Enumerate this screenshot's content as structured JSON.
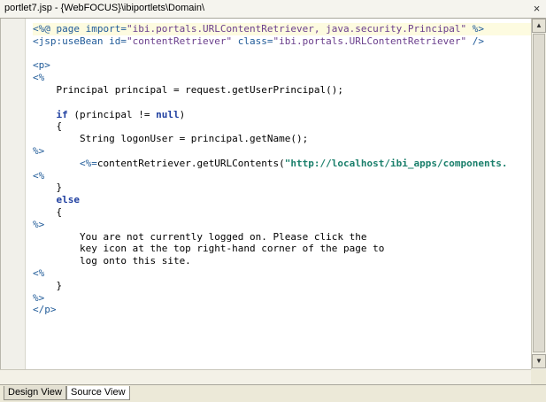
{
  "window": {
    "title": "portlet7.jsp - {WebFOCUS}\\ibiportlets\\Domain\\",
    "close_glyph": "×"
  },
  "editor": {
    "lines": [
      [
        {
          "t": "<%@ page import=",
          "c": "tag"
        },
        {
          "t": "\"ibi.portals.URLContentRetriever, java.security.Principal\"",
          "c": "str"
        },
        {
          "t": " %>",
          "c": "tag"
        }
      ],
      [
        {
          "t": "<jsp:useBean id=",
          "c": "tag"
        },
        {
          "t": "\"contentRetriever\"",
          "c": "str"
        },
        {
          "t": " class=",
          "c": "tag"
        },
        {
          "t": "\"ibi.portals.URLContentRetriever\"",
          "c": "str"
        },
        {
          "t": " />",
          "c": "tag"
        }
      ],
      [],
      [
        {
          "t": "<p>",
          "c": "tag"
        }
      ],
      [
        {
          "t": "<%",
          "c": "tag"
        }
      ],
      [
        {
          "t": "    Principal principal = request.getUserPrincipal();",
          "c": "txt"
        }
      ],
      [],
      [
        {
          "t": "    ",
          "c": "txt"
        },
        {
          "t": "if",
          "c": "kw"
        },
        {
          "t": " (principal != ",
          "c": "txt"
        },
        {
          "t": "null",
          "c": "kw"
        },
        {
          "t": ")",
          "c": "txt"
        }
      ],
      [
        {
          "t": "    {",
          "c": "txt"
        }
      ],
      [
        {
          "t": "        String logonUser = principal.getName();",
          "c": "txt"
        }
      ],
      [
        {
          "t": "%>",
          "c": "tag"
        }
      ],
      [
        {
          "t": "        ",
          "c": "txt"
        },
        {
          "t": "<%=",
          "c": "tag"
        },
        {
          "t": "contentRetriever.getURLContents(",
          "c": "txt"
        },
        {
          "t": "\"http://localhost/ibi_apps/components.",
          "c": "url"
        }
      ],
      [
        {
          "t": "<%",
          "c": "tag"
        }
      ],
      [
        {
          "t": "    }",
          "c": "txt"
        }
      ],
      [
        {
          "t": "    ",
          "c": "txt"
        },
        {
          "t": "else",
          "c": "kw"
        }
      ],
      [
        {
          "t": "    {",
          "c": "txt"
        }
      ],
      [
        {
          "t": "%>",
          "c": "tag"
        }
      ],
      [
        {
          "t": "        You are not currently logged on. Please click the",
          "c": "txt"
        }
      ],
      [
        {
          "t": "        key icon at the top right-hand corner of the page to",
          "c": "txt"
        }
      ],
      [
        {
          "t": "        log onto this site.",
          "c": "txt"
        }
      ],
      [
        {
          "t": "<%",
          "c": "tag"
        }
      ],
      [
        {
          "t": "    }",
          "c": "txt"
        }
      ],
      [
        {
          "t": "%>",
          "c": "tag"
        }
      ],
      [
        {
          "t": "</p>",
          "c": "tag"
        }
      ]
    ]
  },
  "scrollbar": {
    "up_glyph": "▲",
    "down_glyph": "▼"
  },
  "tabs": [
    {
      "label": "Design View",
      "active": false
    },
    {
      "label": "Source View",
      "active": true
    }
  ],
  "colors": {
    "tag": "#1f5a98",
    "string": "#6a3e8c",
    "keyword": "#1f3fa0",
    "url": "#1a7f6b"
  }
}
